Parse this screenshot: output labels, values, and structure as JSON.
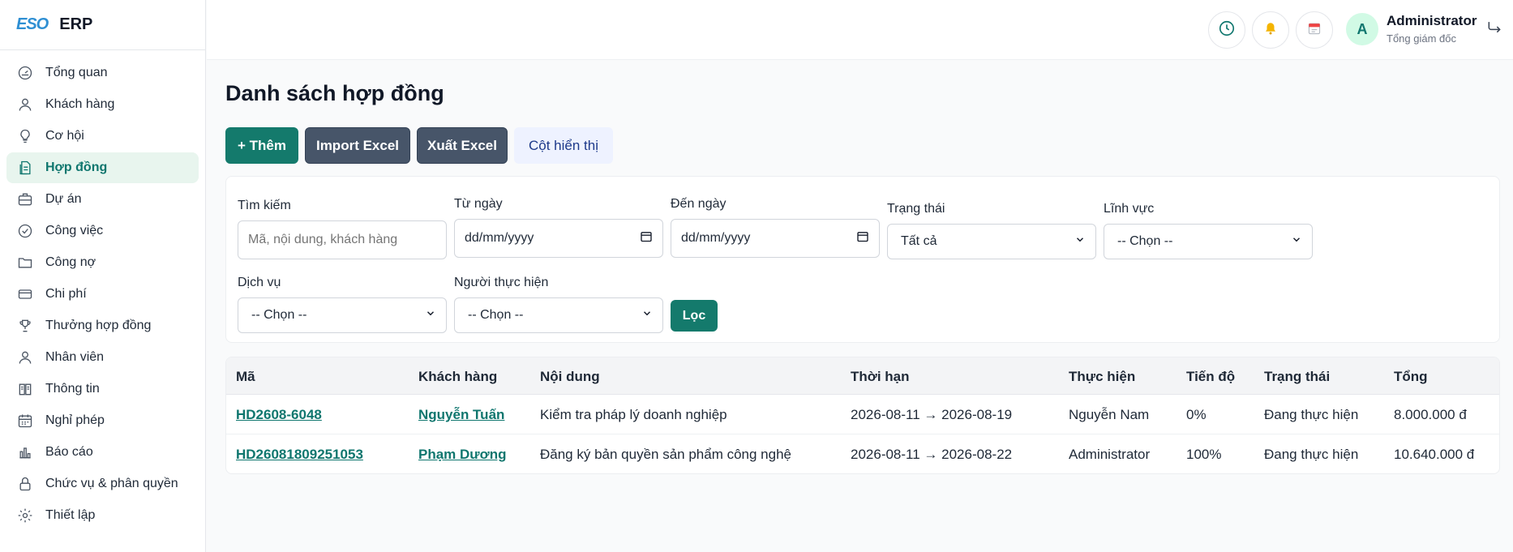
{
  "brand": {
    "logo": "ESO",
    "name": "ERP"
  },
  "sidebar": {
    "items": [
      {
        "label": "Tổng quan",
        "icon": "dashboard-gauge-icon"
      },
      {
        "label": "Khách hàng",
        "icon": "customer-user-icon"
      },
      {
        "label": "Cơ hội",
        "icon": "lightbulb-icon"
      },
      {
        "label": "Hợp đồng",
        "icon": "contract-document-icon",
        "active": true
      },
      {
        "label": "Dự án",
        "icon": "briefcase-icon"
      },
      {
        "label": "Công việc",
        "icon": "check-circle-icon"
      },
      {
        "label": "Công nợ",
        "icon": "folder-icon"
      },
      {
        "label": "Chi phí",
        "icon": "credit-card-icon"
      },
      {
        "label": "Thưởng hợp đồng",
        "icon": "trophy-icon"
      },
      {
        "label": "Nhân viên",
        "icon": "employee-user-icon"
      },
      {
        "label": "Thông tin",
        "icon": "book-icon"
      },
      {
        "label": "Nghỉ phép",
        "icon": "calendar-grid-icon"
      },
      {
        "label": "Báo cáo",
        "icon": "bar-chart-icon"
      },
      {
        "label": "Chức vụ & phân quyền",
        "icon": "lock-icon"
      },
      {
        "label": "Thiết lập",
        "icon": "gear-icon"
      }
    ]
  },
  "topbar": {
    "user": {
      "initial": "A",
      "name": "Administrator",
      "role": "Tổng giám đốc"
    }
  },
  "page": {
    "title": "Danh sách hợp đồng",
    "buttons": {
      "add": "+ Thêm",
      "import": "Import Excel",
      "export": "Xuất Excel",
      "columns": "Cột hiển thị"
    }
  },
  "filters": {
    "search": {
      "label": "Tìm kiếm",
      "placeholder": "Mã, nội dung, khách hàng"
    },
    "from_date": {
      "label": "Từ ngày",
      "value": "dd/mm/yyyy"
    },
    "to_date": {
      "label": "Đến ngày",
      "value": "dd/mm/yyyy"
    },
    "status": {
      "label": "Trạng thái",
      "value": "Tất cả"
    },
    "field": {
      "label": "Lĩnh vực",
      "value": "-- Chọn --"
    },
    "service": {
      "label": "Dịch vụ",
      "value": "-- Chọn --"
    },
    "assignee": {
      "label": "Người thực hiện",
      "value": "-- Chọn --"
    },
    "submit": "Lọc"
  },
  "table": {
    "columns": [
      "Mã",
      "Khách hàng",
      "Nội dung",
      "Thời hạn",
      "Thực hiện",
      "Tiến độ",
      "Trạng thái",
      "Tổng"
    ],
    "rows": [
      {
        "code": "HD2608-6048",
        "customer": "Nguyễn Tuấn",
        "content": "Kiểm tra pháp lý doanh nghiệp",
        "term": "2026-08-11 → 2026-08-19",
        "assignee": "Nguyễn Nam",
        "progress": "0%",
        "status": "Đang thực hiện",
        "total": "8.000.000 đ"
      },
      {
        "code": "HD26081809251053",
        "customer": "Phạm Dương",
        "content": "Đăng ký bản quyền sản phẩm công nghệ",
        "term": "2026-08-11 → 2026-08-22",
        "assignee": "Administrator",
        "progress": "100%",
        "status": "Đang thực hiện",
        "total": "10.640.000 đ"
      }
    ]
  }
}
